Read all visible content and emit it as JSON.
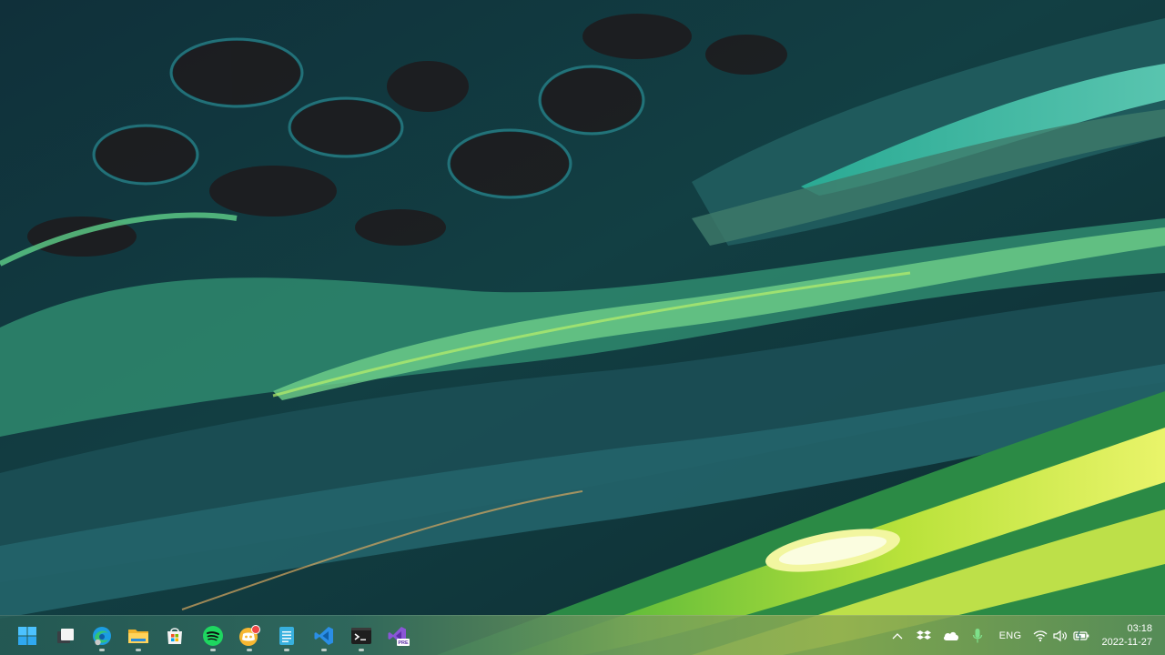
{
  "desktop": {
    "wallpaper": "abstract-fluid-art-green-teal"
  },
  "taskbar": {
    "pinned": [
      {
        "name": "start-button",
        "icon": "windows-logo-icon",
        "running": false
      },
      {
        "name": "task-view-button",
        "icon": "task-view-icon",
        "running": false
      },
      {
        "name": "edge-button",
        "icon": "edge-icon",
        "running": true
      },
      {
        "name": "file-explorer-button",
        "icon": "folder-icon",
        "running": true
      },
      {
        "name": "microsoft-store-button",
        "icon": "store-icon",
        "running": false
      },
      {
        "name": "spotify-button",
        "icon": "spotify-icon",
        "running": true
      },
      {
        "name": "discord-button",
        "icon": "discord-icon",
        "running": true
      },
      {
        "name": "notepad-button",
        "icon": "notepad-icon",
        "running": true
      },
      {
        "name": "vscode-button",
        "icon": "vscode-icon",
        "running": true
      },
      {
        "name": "terminal-button",
        "icon": "terminal-icon",
        "running": true
      },
      {
        "name": "visual-studio-preview-button",
        "icon": "visual-studio-icon",
        "running": false
      }
    ],
    "badges": {
      "visual_studio": "PRE"
    },
    "tray": {
      "language": "ENG",
      "time": "03:18",
      "date": "2022-11-27"
    }
  }
}
